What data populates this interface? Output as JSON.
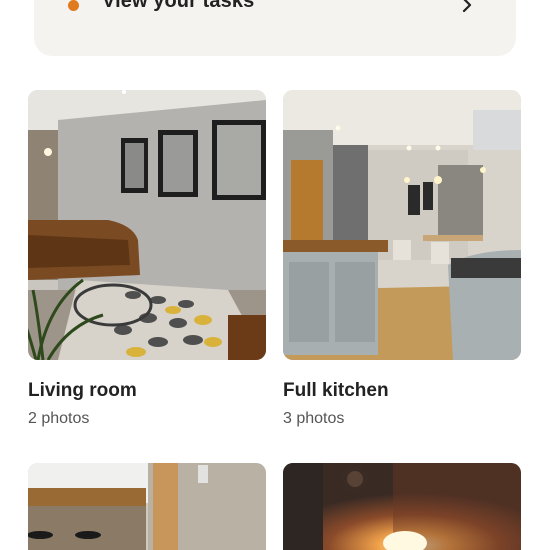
{
  "tasks_banner": {
    "label": "View your tasks",
    "dot_color": "#e07a1f",
    "icon": "chevron-right-icon"
  },
  "rooms": [
    {
      "name": "Living room",
      "photo_count": "2 photos"
    },
    {
      "name": "Full kitchen",
      "photo_count": "3 photos"
    },
    {
      "name": "",
      "photo_count": ""
    },
    {
      "name": "",
      "photo_count": ""
    }
  ]
}
